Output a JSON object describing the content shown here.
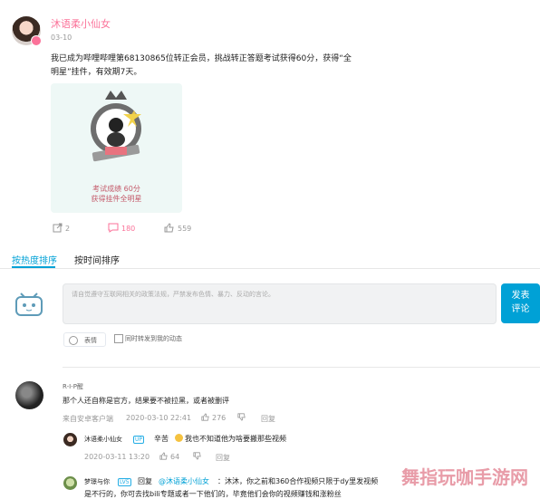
{
  "post": {
    "author": "沐语柔小仙女",
    "date": "03-10",
    "text_line1": "我已成为哔哩哔哩第68130865位转正会员，挑战转正答题考试获得60分，获得“全",
    "text_line2": "明星”挂件，有效期7天。",
    "card_caption1": "考试成绩 60分",
    "card_caption2": "获得挂件全明星",
    "share_count": "2",
    "comment_count": "180",
    "like_count": "559"
  },
  "tabs": {
    "hot": "按热度排序",
    "time": "按时间排序"
  },
  "composer": {
    "placeholder": "请自觉遵守互联网相关的政策法规，严禁发布色情、暴力、反动的言论。",
    "send_line1": "发表",
    "send_line2": "评论",
    "emoji_label": "表情",
    "repost_label": "同时转发到我的动态"
  },
  "comments": [
    {
      "user": "R-I-P醒",
      "text": "那个人还自称是官方，结果要不被拉黑，或者被删评",
      "device": "来自安卓客户端",
      "time": "2020-03-10 22:41",
      "likes": "276",
      "reply_label": "回复",
      "replies": [
        {
          "user": "沐语柔小仙女",
          "badge": "UP",
          "text_a": "辛苦",
          "text_b": "我也不知道他为啥要搬那些视频",
          "time": "2020-03-11 13:20",
          "likes": "64",
          "reply_label": "回复"
        },
        {
          "user": "梦璟与你",
          "badge": "LV5",
          "text_a": "回复",
          "mention": "@沐语柔小仙女",
          "text_b": "：沐沐，你之前和360合作视频只限于dy里发视频",
          "text_line2": "是不行的，你可去找bili专题或者一下他们的，毕竟他们会你的视频赚钱和涨粉丝"
        }
      ]
    }
  ],
  "watermark": "舞指玩咖手游网",
  "colors": {
    "accent": "#00a1d6",
    "pink": "#fb7299",
    "mention": "#00a1d6"
  }
}
